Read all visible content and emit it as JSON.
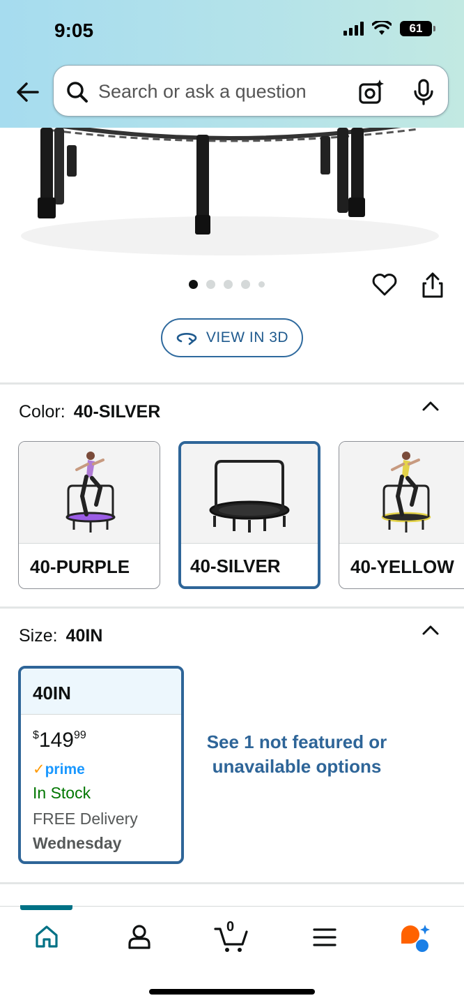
{
  "status_bar": {
    "time": "9:05",
    "battery": "61"
  },
  "search": {
    "placeholder": "Search or ask a question"
  },
  "gallery": {
    "dot_count": 5,
    "active_index": 0,
    "view_3d_label": "VIEW IN 3D"
  },
  "color": {
    "label": "Color:",
    "selected": "40-SILVER",
    "options": [
      {
        "name": "40-PURPLE",
        "accent": "#9b5de5"
      },
      {
        "name": "40-SILVER",
        "accent": "#9aa0a6"
      },
      {
        "name": "40-YELLOW",
        "accent": "#e4d34a"
      }
    ]
  },
  "size": {
    "label": "Size:",
    "selected": "40IN",
    "card": {
      "name": "40IN",
      "price_currency": "$",
      "price_whole": "149",
      "price_fraction": "99",
      "prime_label": "prime",
      "stock": "In Stock",
      "delivery": "FREE Delivery",
      "delivery_day": "Wednesday"
    },
    "see_more": "See 1 not featured or unavailable options"
  },
  "bottom_nav": {
    "items": [
      "home-icon",
      "account-icon",
      "cart-icon",
      "menu-icon",
      "rufus-icon"
    ],
    "active": "home-icon",
    "cart_count": "0"
  },
  "colors": {
    "accent_blue": "#2e6598",
    "teal": "#007185",
    "in_stock": "#007600"
  }
}
